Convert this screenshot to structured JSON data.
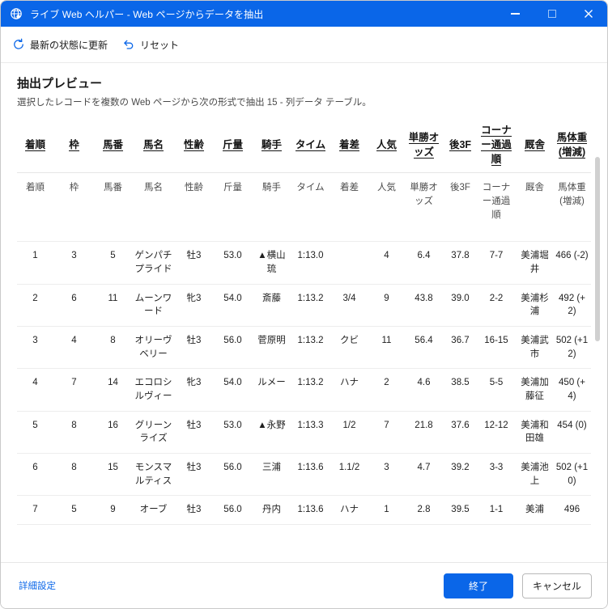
{
  "window": {
    "title": "ライブ Web ヘルパー - Web ページからデータを抽出",
    "minimize_label": "最小化",
    "maximize_label": "最大化",
    "close_label": "閉じる",
    "accent_color": "#0a66e8"
  },
  "toolbar": {
    "refresh_label": "最新の状態に更新",
    "reset_label": "リセット"
  },
  "preview": {
    "heading": "抽出プレビュー",
    "subheading": "選択したレコードを複数の Web ページから次の形式で抽出 15 - 列データ テーブル。"
  },
  "table": {
    "headers": [
      "着順",
      "枠",
      "馬番",
      "馬名",
      "性齢",
      "斤量",
      "騎手",
      "タイム",
      "着差",
      "人気",
      "単勝オッズ",
      "後3F",
      "コーナー通過順",
      "厩舎",
      "馬体重(増減)"
    ],
    "subheaders": [
      "着順",
      "枠",
      "馬番",
      "馬名",
      "性齢",
      "斤量",
      "騎手",
      "タイム",
      "着差",
      "人気",
      "単勝オッズ",
      "後3F",
      "コーナー通過順",
      "厩舎",
      "馬体重(増減)"
    ],
    "rows": [
      {
        "chakujun": "1",
        "waku": "3",
        "umaban": "5",
        "bamei": "ゲンパチプライド",
        "seirei": "牡3",
        "kinryo": "53.0",
        "kishu": "▲横山琉",
        "time": "1:13.0",
        "chakusa": "",
        "ninki": "4",
        "odds": "6.4",
        "ago3f": "37.8",
        "corner": "7-7",
        "kyusha": "美浦堀井",
        "taiju": "466 (-2)"
      },
      {
        "chakujun": "2",
        "waku": "6",
        "umaban": "11",
        "bamei": "ムーンワード",
        "seirei": "牝3",
        "kinryo": "54.0",
        "kishu": "斎藤",
        "time": "1:13.2",
        "chakusa": "3/4",
        "ninki": "9",
        "odds": "43.8",
        "ago3f": "39.0",
        "corner": "2-2",
        "kyusha": "美浦杉浦",
        "taiju": "492 (+2)"
      },
      {
        "chakujun": "3",
        "waku": "4",
        "umaban": "8",
        "bamei": "オリーヴベリー",
        "seirei": "牡3",
        "kinryo": "56.0",
        "kishu": "菅原明",
        "time": "1:13.2",
        "chakusa": "クビ",
        "ninki": "11",
        "odds": "56.4",
        "ago3f": "36.7",
        "corner": "16-15",
        "kyusha": "美浦武市",
        "taiju": "502 (+12)"
      },
      {
        "chakujun": "4",
        "waku": "7",
        "umaban": "14",
        "bamei": "エコロシルヴィー",
        "seirei": "牝3",
        "kinryo": "54.0",
        "kishu": "ルメー",
        "time": "1:13.2",
        "chakusa": "ハナ",
        "ninki": "2",
        "odds": "4.6",
        "ago3f": "38.5",
        "corner": "5-5",
        "kyusha": "美浦加藤征",
        "taiju": "450 (+4)"
      },
      {
        "chakujun": "5",
        "waku": "8",
        "umaban": "16",
        "bamei": "グリーンライズ",
        "seirei": "牡3",
        "kinryo": "53.0",
        "kishu": "▲永野",
        "time": "1:13.3",
        "chakusa": "1/2",
        "ninki": "7",
        "odds": "21.8",
        "ago3f": "37.6",
        "corner": "12-12",
        "kyusha": "美浦和田雄",
        "taiju": "454 (0)"
      },
      {
        "chakujun": "6",
        "waku": "8",
        "umaban": "15",
        "bamei": "モンスマルティス",
        "seirei": "牡3",
        "kinryo": "56.0",
        "kishu": "三浦",
        "time": "1:13.6",
        "chakusa": "1.1/2",
        "ninki": "3",
        "odds": "4.7",
        "ago3f": "39.2",
        "corner": "3-3",
        "kyusha": "美浦池上",
        "taiju": "502 (+10)"
      },
      {
        "chakujun": "7",
        "waku": "5",
        "umaban": "9",
        "bamei": "オーブ",
        "seirei": "牡3",
        "kinryo": "56.0",
        "kishu": "丹内",
        "time": "1:13.6",
        "chakusa": "ハナ",
        "ninki": "1",
        "odds": "2.8",
        "ago3f": "39.5",
        "corner": "1-1",
        "kyusha": "美浦",
        "taiju": "496"
      }
    ]
  },
  "footer": {
    "advanced_label": "詳細設定",
    "finish_label": "終了",
    "cancel_label": "キャンセル"
  }
}
